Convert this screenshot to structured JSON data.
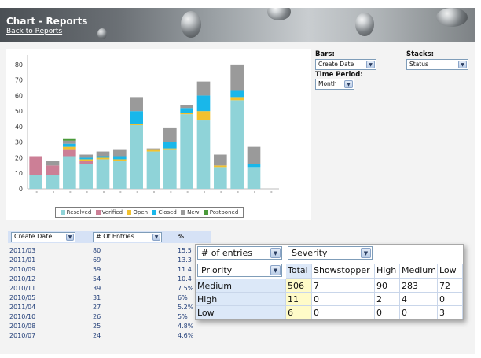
{
  "header": {
    "title": "Chart - Reports",
    "back_link": "Back to Reports"
  },
  "controls": {
    "bars_label": "Bars:",
    "bars_value": "Create Date",
    "stacks_label": "Stacks:",
    "stacks_value": "Status",
    "period_label": "Time Period:",
    "period_value": "Month"
  },
  "colors": {
    "resolved": "#8fd3d8",
    "verified": "#cc7f96",
    "open": "#f2c12e",
    "closed": "#19b7ea",
    "new": "#9a9a9a",
    "postponed": "#4a9a3a"
  },
  "chart_data": {
    "type": "bar",
    "stacked": true,
    "ylim": [
      0,
      85
    ],
    "yticks": [
      0,
      10,
      20,
      30,
      40,
      50,
      60,
      70,
      80
    ],
    "grid": false,
    "legend_position": "bottom",
    "categories": [
      "",
      "",
      "",
      "",
      "",
      "",
      "",
      "",
      "",
      "",
      "",
      "",
      "",
      "",
      ""
    ],
    "series": [
      {
        "name": "Resolved",
        "values": [
          9,
          9,
          21,
          16,
          19,
          18,
          41,
          24,
          25,
          48,
          44,
          14,
          57,
          14,
          0
        ]
      },
      {
        "name": "Verified",
        "values": [
          12,
          6,
          4,
          2,
          0,
          0,
          0,
          0,
          0,
          0,
          0,
          0,
          0,
          0,
          0
        ]
      },
      {
        "name": "Open",
        "values": [
          0,
          0,
          2,
          1,
          1,
          1,
          1,
          1,
          1,
          1,
          6,
          1,
          2,
          0,
          0
        ]
      },
      {
        "name": "Closed",
        "values": [
          0,
          0,
          2,
          1,
          1,
          2,
          8,
          0,
          4,
          3,
          10,
          0,
          4,
          2,
          0
        ]
      },
      {
        "name": "New",
        "values": [
          0,
          3,
          2,
          2,
          3,
          4,
          9,
          1,
          9,
          2,
          9,
          7,
          17,
          11,
          0
        ]
      },
      {
        "name": "Postponed",
        "values": [
          0,
          0,
          1,
          0,
          0,
          0,
          0,
          0,
          0,
          0,
          0,
          0,
          0,
          0,
          0
        ]
      }
    ]
  },
  "legend": [
    "Resolved",
    "Verified",
    "Open",
    "Closed",
    "New",
    "Postponed"
  ],
  "table": {
    "col1": "Create Date",
    "col2": "# Of Entries",
    "col3": "%",
    "rows": [
      {
        "date": "2011/03",
        "entries": "80",
        "pct": "15.5"
      },
      {
        "date": "2011/01",
        "entries": "69",
        "pct": "13.3"
      },
      {
        "date": "2010/09",
        "entries": "59",
        "pct": "11.4"
      },
      {
        "date": "2010/12",
        "entries": "54",
        "pct": "10.4"
      },
      {
        "date": "2010/11",
        "entries": "39",
        "pct": "7.5%"
      },
      {
        "date": "2010/05",
        "entries": "31",
        "pct": "6%"
      },
      {
        "date": "2011/04",
        "entries": "27",
        "pct": "5.2%"
      },
      {
        "date": "2010/10",
        "entries": "26",
        "pct": "5%"
      },
      {
        "date": "2010/08",
        "entries": "25",
        "pct": "4.8%"
      },
      {
        "date": "2010/07",
        "entries": "24",
        "pct": "4.6%"
      }
    ]
  },
  "pivot": {
    "measure": "# of entries",
    "column_field": "Severity",
    "row_field": "Priority",
    "headers": [
      "Total",
      "Showstopper",
      "High",
      "Medium",
      "Low"
    ],
    "rows": [
      {
        "label": "Medium",
        "values": [
          "506",
          "7",
          "90",
          "283",
          "72"
        ]
      },
      {
        "label": "High",
        "values": [
          "11",
          "0",
          "2",
          "4",
          "0"
        ]
      },
      {
        "label": "Low",
        "values": [
          "6",
          "0",
          "0",
          "0",
          "3"
        ]
      }
    ]
  }
}
